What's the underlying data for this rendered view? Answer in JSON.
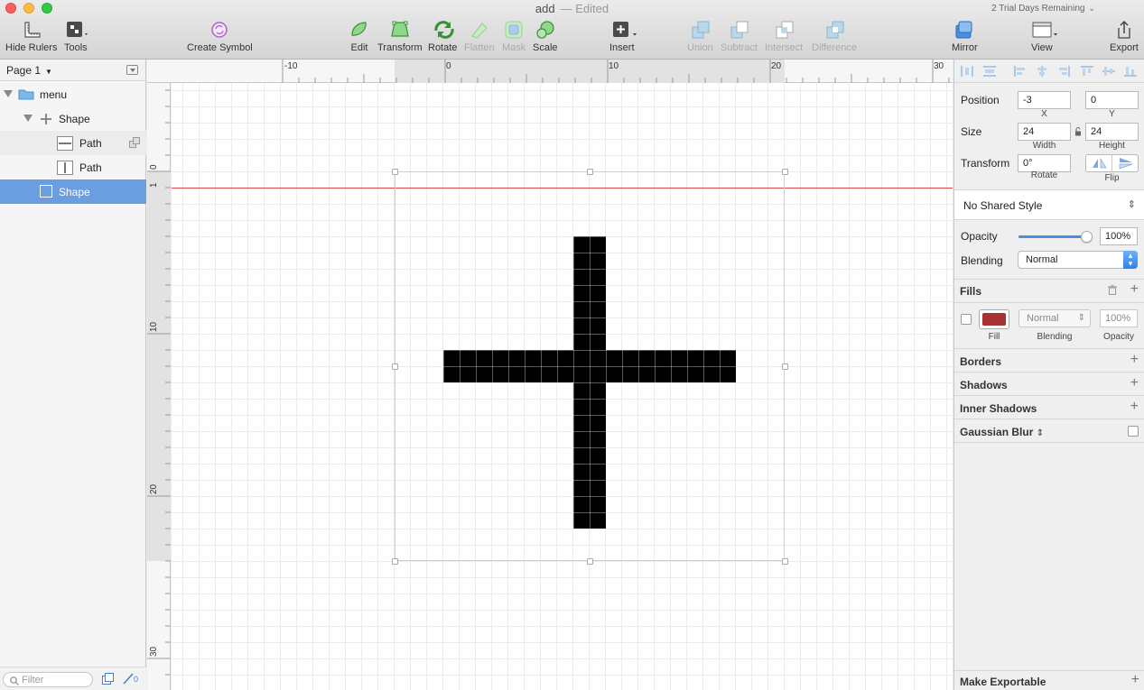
{
  "window": {
    "title": "add",
    "edited_label": "— Edited",
    "trial_text": "2 Trial Days Remaining"
  },
  "toolbar": {
    "hide_rulers": "Hide Rulers",
    "tools": "Tools",
    "create_symbol": "Create Symbol",
    "edit": "Edit",
    "transform": "Transform",
    "rotate": "Rotate",
    "flatten": "Flatten",
    "mask": "Mask",
    "scale": "Scale",
    "insert": "Insert",
    "union": "Union",
    "subtract": "Subtract",
    "intersect": "Intersect",
    "difference": "Difference",
    "mirror": "Mirror",
    "view": "View",
    "export": "Export"
  },
  "layers": {
    "page_name": "Page 1",
    "items": [
      {
        "label": "menu",
        "type": "folder"
      },
      {
        "label": "Shape",
        "type": "shape-group"
      },
      {
        "label": "Path",
        "type": "path-horizontal"
      },
      {
        "label": "Path",
        "type": "path-vertical"
      },
      {
        "label": "Shape",
        "type": "shape",
        "selected": true
      }
    ],
    "filter_placeholder": "Filter",
    "slice_count": "0"
  },
  "rulers": {
    "top_labels": [
      "-10",
      "0",
      "10",
      "20",
      "30"
    ],
    "left_labels": [
      "0",
      "1",
      "10",
      "20",
      "30"
    ]
  },
  "inspector": {
    "position_label": "Position",
    "x_value": "-3",
    "y_value": "0",
    "x_label": "X",
    "y_label": "Y",
    "size_label": "Size",
    "width_value": "24",
    "height_value": "24",
    "width_label": "Width",
    "height_label": "Height",
    "transform_label": "Transform",
    "rotate_value": "0°",
    "rotate_label": "Rotate",
    "flip_label": "Flip",
    "shared_style": "No Shared Style",
    "opacity_label": "Opacity",
    "opacity_value": "100%",
    "opacity_fraction": 1.0,
    "blending_label": "Blending",
    "blending_value": "Normal",
    "fills": {
      "title": "Fills",
      "fill_label": "Fill",
      "blending_label": "Blending",
      "opacity_label": "Opacity",
      "blending_value": "Normal",
      "opacity_value": "100%",
      "color": "#a83232"
    },
    "borders": "Borders",
    "shadows": "Shadows",
    "inner_shadows": "Inner Shadows",
    "gaussian_blur": "Gaussian Blur",
    "make_exportable": "Make Exportable"
  },
  "colors": {
    "accent": "#4a90e2",
    "selection": "#6b9ee0",
    "guide": "#e04a4a",
    "shape": "#000000"
  }
}
